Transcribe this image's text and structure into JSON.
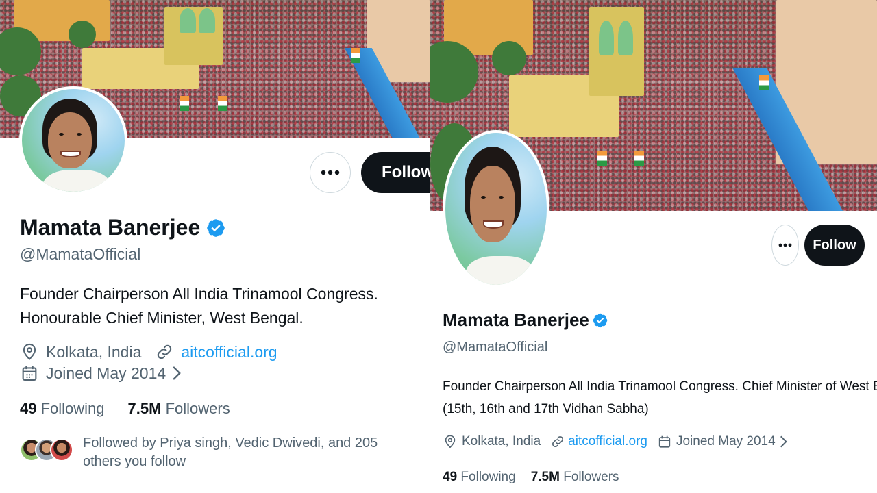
{
  "left": {
    "name": "Mamata Banerjee",
    "handle": "@MamataOfficial",
    "bio_line1": "Founder Chairperson All India Trinamool Congress.",
    "bio_line2": "Honourable Chief Minister, West Bengal.",
    "location": "Kolkata, India",
    "website": "aitcofficial.org",
    "joined": "Joined May 2014",
    "following_count": "49",
    "following_label": "Following",
    "followers_count": "7.5M",
    "followers_label": "Followers",
    "followed_by": "Followed by Priya singh, Vedic Dwivedi, and 205 others you follow",
    "follow_button": "Follow",
    "more_button": "•••"
  },
  "right": {
    "name": "Mamata Banerjee",
    "handle": "@MamataOfficial",
    "bio_line1": "Founder Chairperson All India Trinamool Congress. Chief Minister of West Bengal",
    "bio_line2": "(15th, 16th and 17th Vidhan Sabha)",
    "location": "Kolkata, India",
    "website": "aitcofficial.org",
    "joined": "Joined May 2014",
    "following_count": "49",
    "following_label": "Following",
    "followers_count": "7.5M",
    "followers_label": "Followers",
    "follow_button": "Follow",
    "more_button": "•••"
  },
  "colors": {
    "verified_badge": "#1d9bf0",
    "link": "#1d9bf0",
    "follow_button_bg": "#0f1419",
    "secondary_text": "#536471"
  },
  "icons": [
    "verified-badge-icon",
    "location-icon",
    "link-icon",
    "calendar-icon",
    "chevron-right-icon",
    "more-icon"
  ]
}
